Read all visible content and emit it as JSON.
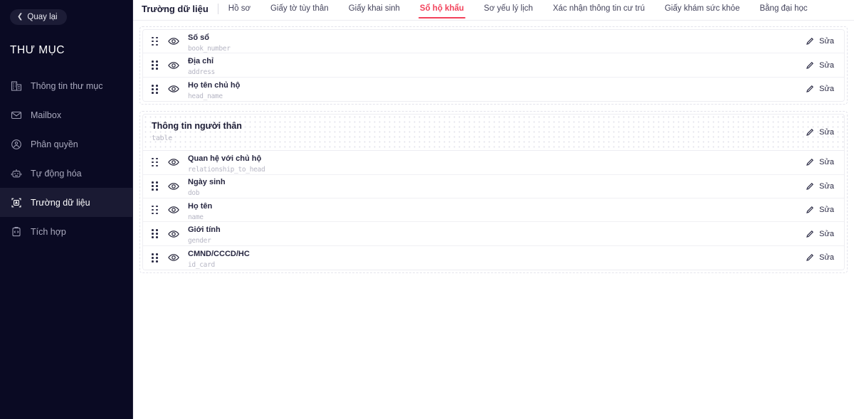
{
  "sidebar": {
    "back_label": "Quay lại",
    "brand": "THƯ MỤC",
    "items": [
      {
        "label": "Thông tin thư mục",
        "icon": "building-info-icon",
        "active": false
      },
      {
        "label": "Mailbox",
        "icon": "mail-icon",
        "active": false
      },
      {
        "label": "Phân quyền",
        "icon": "permissions-icon",
        "active": false
      },
      {
        "label": "Tự động hóa",
        "icon": "robot-icon",
        "active": false
      },
      {
        "label": "Trường dữ liệu",
        "icon": "data-field-icon",
        "active": true
      },
      {
        "label": "Tích hợp",
        "icon": "integration-icon",
        "active": false
      }
    ]
  },
  "tabs": {
    "title": "Trường dữ liệu",
    "items": [
      {
        "label": "Hồ sơ",
        "active": false
      },
      {
        "label": "Giấy tờ tùy thân",
        "active": false
      },
      {
        "label": "Giấy khai sinh",
        "active": false
      },
      {
        "label": "Sổ hộ khẩu",
        "active": true
      },
      {
        "label": "Sơ yếu lý lịch",
        "active": false
      },
      {
        "label": "Xác nhận thông tin cư trú",
        "active": false
      },
      {
        "label": "Giấy khám sức khỏe",
        "active": false
      },
      {
        "label": "Bằng đại học",
        "active": false
      }
    ]
  },
  "edit_label": "Sửa",
  "sections": [
    {
      "header": null,
      "rows": [
        {
          "label": "Số sổ",
          "key": "book_number"
        },
        {
          "label": "Địa chỉ",
          "key": "address"
        },
        {
          "label": "Họ tên chủ hộ",
          "key": "head_name"
        }
      ]
    },
    {
      "header": {
        "title": "Thông tin người thân",
        "subtitle": "table"
      },
      "rows": [
        {
          "label": "Quan hệ với chủ hộ",
          "key": "relationship_to_head"
        },
        {
          "label": "Ngày sinh",
          "key": "dob"
        },
        {
          "label": "Họ tên",
          "key": "name"
        },
        {
          "label": "Giới tính",
          "key": "gender"
        },
        {
          "label": "CMND/CCCD/HC",
          "key": "id_card"
        }
      ]
    }
  ],
  "colors": {
    "sidebar_bg": "#0a0a23",
    "accent": "#f2415a",
    "text_dark": "#1c1c35"
  }
}
